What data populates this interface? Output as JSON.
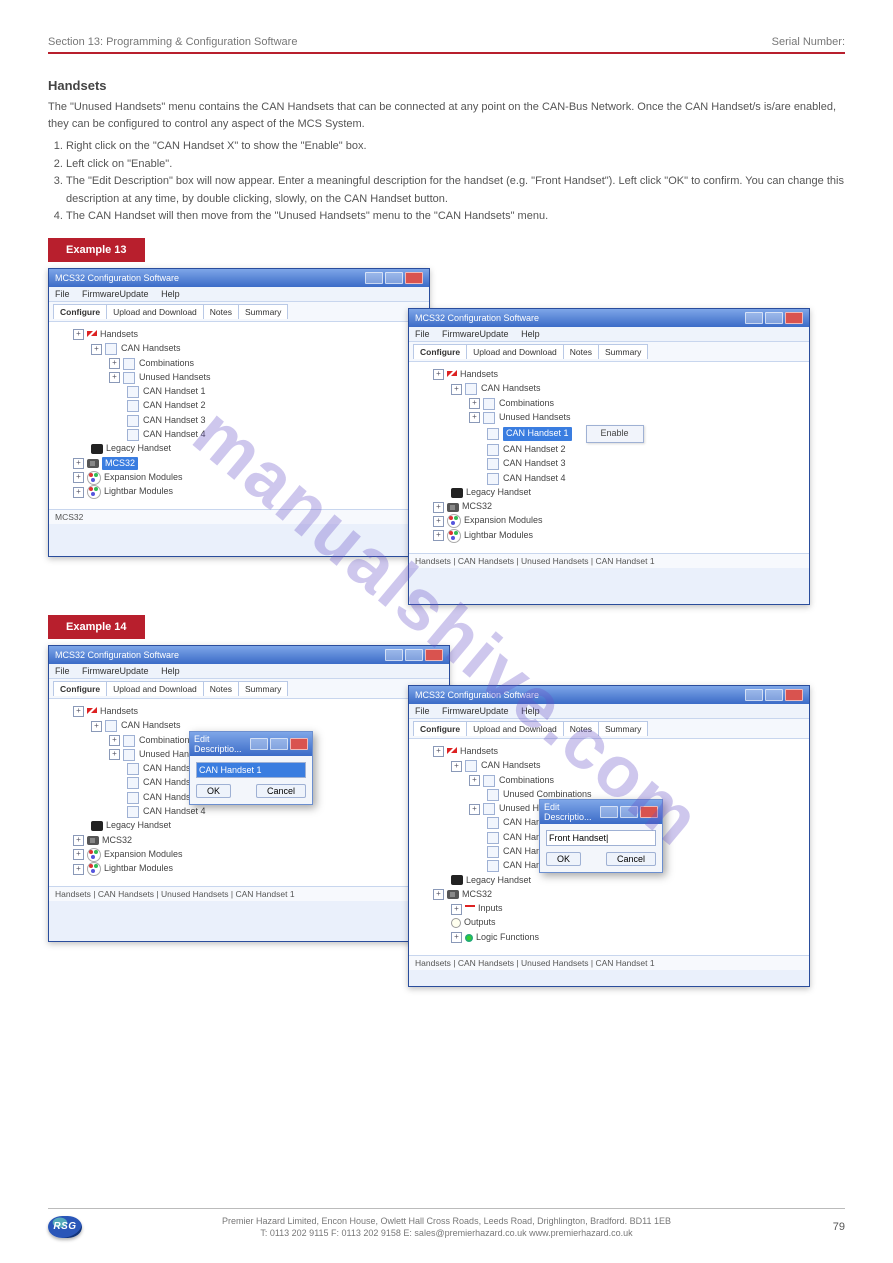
{
  "header": {
    "left": "Section 13: Programming & Configuration Software",
    "right": "Serial Number:"
  },
  "h1": "Handsets",
  "p_intro": "The \"Unused Handsets\" menu contains the CAN Handsets that can be connected at any point on the CAN-Bus Network. Once the CAN Handset/s is/are enabled, they can be configured to control any aspect of the MCS System.",
  "list": [
    "Right click on the \"CAN Handset X\" to show the \"Enable\" box.",
    "Left click on \"Enable\".",
    "The \"Edit Description\" box will now appear. Enter a meaningful description for the handset (e.g. \"Front Handset\"). Left click \"OK\" to confirm. You can change this description at any time, by double clicking, slowly, on the CAN Handset button.",
    "The CAN Handset will then move from the \"Unused Handsets\" menu to the \"CAN Handsets\" menu."
  ],
  "example13_label": "Example 13",
  "example14_label": "Example 14",
  "app_title": "MCS32 Configuration Software",
  "menus": {
    "file": "File",
    "fw": "FirmwareUpdate",
    "help": "Help"
  },
  "tabs": {
    "conf": "Configure",
    "ud": "Upload and Download",
    "notes": "Notes",
    "summary": "Summary"
  },
  "tree": {
    "handsets": "Handsets",
    "can": "CAN Handsets",
    "comb": "Combinations",
    "unused": "Unused Handsets",
    "unused_comb": "Unused Combinations",
    "c1": "CAN Handset 1",
    "c2": "CAN Handset 2",
    "c3": "CAN Handset 3",
    "c4": "CAN Handset 4",
    "legacy": "Legacy Handset",
    "mcs": "MCS32",
    "exp": "Expansion Modules",
    "lbar": "Lightbar Modules",
    "inputs": "Inputs",
    "outputs": "Outputs",
    "logic": "Logic Functions"
  },
  "enable_btn": "Enable",
  "status_mcs": "MCS32",
  "status_path": "Handsets | CAN Handsets | Unused Handsets | CAN Handset 1",
  "dialog": {
    "title": "Edit Descriptio...",
    "val1": "CAN Handset 1",
    "val2": "Front Handset|",
    "ok": "OK",
    "cancel": "Cancel"
  },
  "watermark": "manualshive.com",
  "footer": {
    "logo": "RSG",
    "line1": "Premier Hazard Limited, Encon House, Owlett Hall Cross Roads, Leeds Road, Drighlington, Bradford. BD11 1EB",
    "line2": "T: 0113 202 9115    F: 0113 202 9158   E: sales@premierhazard.co.uk   www.premierhazard.co.uk",
    "page": "79"
  }
}
